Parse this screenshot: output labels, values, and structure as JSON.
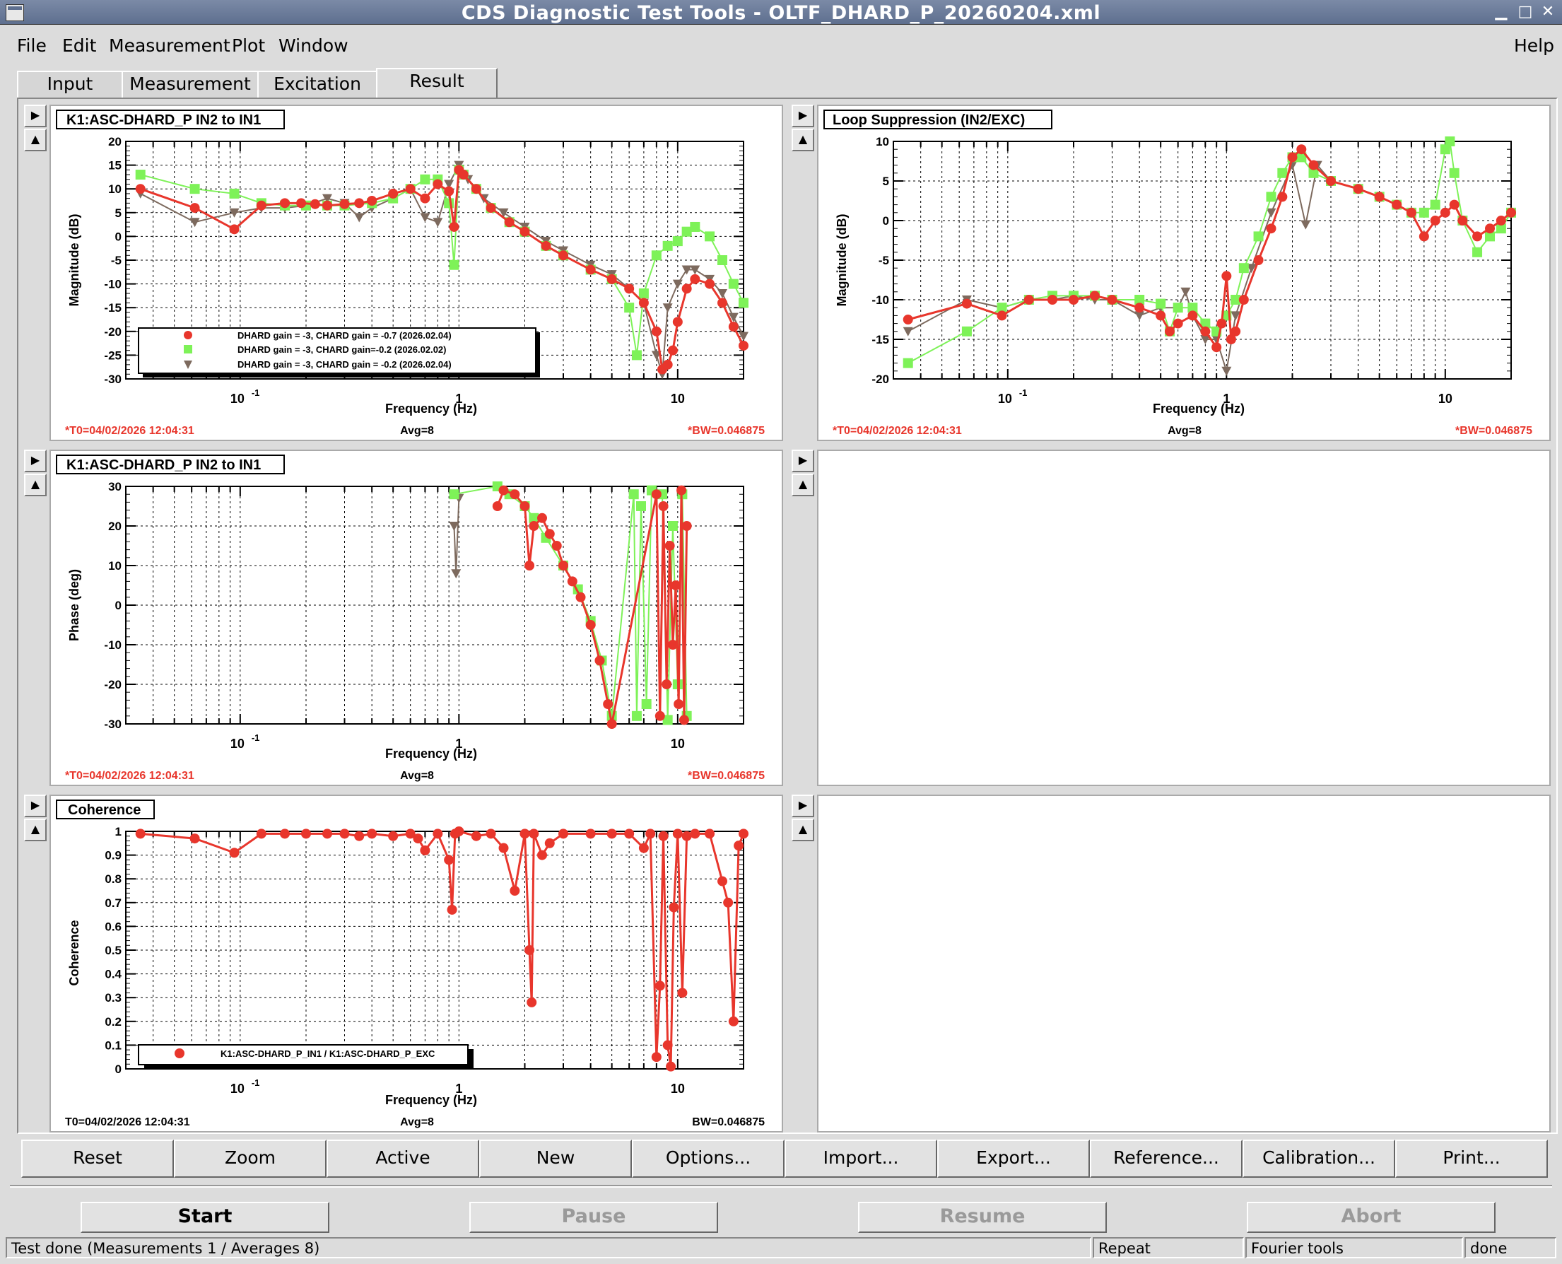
{
  "window": {
    "title": "CDS Diagnostic Test Tools - OLTF_DHARD_P_20260204.xml",
    "minimize": "▁",
    "maximize": "□",
    "close": "✕"
  },
  "menu": {
    "file": "File",
    "edit": "Edit",
    "measurement": "Measurement",
    "plot": "Plot",
    "window": "Window",
    "help": "Help"
  },
  "tabs": {
    "input": "Input",
    "measurement": "Measurement",
    "excitation": "Excitation",
    "result": "Result"
  },
  "colors": {
    "series1": "#e8362c",
    "series2": "#7ef258",
    "series3": "#7d6a5e",
    "info_red": "#e8362c"
  },
  "pads": {
    "mag": {
      "title": "K1:ASC-DHARD_P IN2 to IN1",
      "ylabel": "Magnitude (dB)",
      "xlabel": "Frequency (Hz)",
      "footer_left": "*T0=04/02/2026 12:04:31",
      "footer_mid": "Avg=8",
      "footer_right": "*BW=0.046875",
      "legend": [
        "DHARD gain = -3, CHARD gain = -0.7 (2026.02.04)",
        "DHARD gain = -3, CHARD gain=-0.2  (2026.02.02)",
        "DHARD gain = -3, CHARD gain = -0.2 (2026.02.04)"
      ]
    },
    "supp": {
      "title": "Loop Suppression (IN2/EXC)",
      "ylabel": "Magnitude (dB)",
      "xlabel": "Frequency (Hz)",
      "footer_left": "*T0=04/02/2026 12:04:31",
      "footer_mid": "Avg=8",
      "footer_right": "*BW=0.046875"
    },
    "phase": {
      "title": "K1:ASC-DHARD_P IN2 to IN1",
      "ylabel": "Phase (deg)",
      "xlabel": "Frequency (Hz)",
      "footer_left": "*T0=04/02/2026 12:04:31",
      "footer_mid": "Avg=8",
      "footer_right": "*BW=0.046875"
    },
    "coh": {
      "title": "Coherence",
      "ylabel": "Coherence",
      "xlabel": "Frequency (Hz)",
      "footer_left": "T0=04/02/2026 12:04:31",
      "footer_mid": "Avg=8",
      "footer_right": "BW=0.046875",
      "legend": [
        "K1:ASC-DHARD_P_IN1 / K1:ASC-DHARD_P_EXC"
      ]
    }
  },
  "toolbar": {
    "reset": "Reset",
    "zoom": "Zoom",
    "active": "Active",
    "new": "New",
    "options": "Options...",
    "import": "Import...",
    "export": "Export...",
    "reference": "Reference...",
    "calibration": "Calibration...",
    "print": "Print..."
  },
  "controls": {
    "start": "Start",
    "pause": "Pause",
    "resume": "Resume",
    "abort": "Abort"
  },
  "status": {
    "message": "Test done (Measurements 1 / Averages 8)",
    "repeat": "Repeat",
    "tool": "Fourier tools",
    "state": "done"
  },
  "chart_data": [
    {
      "id": "mag",
      "type": "scatter",
      "title": "K1:ASC-DHARD_P IN2 to IN1",
      "xlabel": "Frequency (Hz)",
      "ylabel": "Magnitude (dB)",
      "xscale": "log",
      "xlim": [
        0.03,
        20
      ],
      "ylim": [
        -30,
        20
      ],
      "yticks": [
        -30,
        -25,
        -20,
        -15,
        -10,
        -5,
        0,
        5,
        10,
        15,
        20
      ],
      "xticklabels": [
        "10^-1",
        "1",
        "10"
      ],
      "grid": true,
      "legend": "bottom-left",
      "series": [
        {
          "name": "DHARD gain = -3, CHARD gain = -0.7 (2026.02.04)",
          "marker": "circle",
          "x": [
            0.035,
            0.062,
            0.094,
            0.125,
            0.16,
            0.19,
            0.22,
            0.25,
            0.3,
            0.35,
            0.4,
            0.5,
            0.6,
            0.7,
            0.8,
            0.9,
            0.95,
            1.0,
            1.05,
            1.2,
            1.4,
            1.7,
            2.0,
            2.5,
            3,
            4,
            5,
            6,
            7,
            8,
            8.5,
            9,
            9.5,
            10,
            11,
            12,
            14,
            16,
            18,
            20
          ],
          "y": [
            10,
            6,
            1.5,
            6.5,
            7,
            7,
            6.8,
            6.5,
            6.8,
            7,
            7.5,
            9,
            10,
            8,
            11,
            9.5,
            2,
            14,
            13,
            10,
            6,
            3,
            1,
            -2,
            -4,
            -7,
            -9,
            -11,
            -14,
            -20,
            -28,
            -27,
            -24,
            -18,
            -11,
            -9,
            -10,
            -14,
            -19,
            -23
          ]
        },
        {
          "name": "DHARD gain = -3, CHARD gain=-0.2  (2026.02.02)",
          "marker": "square",
          "x": [
            0.035,
            0.062,
            0.094,
            0.125,
            0.16,
            0.2,
            0.25,
            0.3,
            0.4,
            0.5,
            0.6,
            0.7,
            0.8,
            0.9,
            0.95,
            1.0,
            1.05,
            1.2,
            1.4,
            1.7,
            2.0,
            2.5,
            3,
            4,
            5,
            6,
            6.5,
            7,
            8,
            9,
            10,
            11,
            12,
            14,
            16,
            18,
            20
          ],
          "y": [
            13,
            10,
            9,
            7,
            6.5,
            6.5,
            6.5,
            6.5,
            7,
            8,
            10,
            12,
            12,
            7,
            -6,
            14,
            13,
            10,
            6,
            3,
            1,
            -2,
            -4,
            -7,
            -9,
            -15,
            -25,
            -12,
            -4,
            -2,
            -1,
            1,
            2,
            0,
            -5,
            -10,
            -14
          ]
        },
        {
          "name": "DHARD gain = -3, CHARD gain = -0.2 (2026.02.04)",
          "marker": "triangle-down",
          "x": [
            0.035,
            0.062,
            0.094,
            0.125,
            0.16,
            0.2,
            0.25,
            0.3,
            0.35,
            0.4,
            0.5,
            0.6,
            0.7,
            0.8,
            0.9,
            1.0,
            1.1,
            1.3,
            1.6,
            2.0,
            2.5,
            3,
            4,
            5,
            6,
            7,
            8,
            8.5,
            9,
            10,
            11,
            12,
            14,
            16,
            18,
            20
          ],
          "y": [
            9,
            3,
            5,
            6,
            6,
            6.5,
            8,
            7,
            4,
            6,
            8,
            10,
            4,
            3,
            11,
            15,
            12,
            8,
            5,
            2,
            -1,
            -3,
            -6,
            -8,
            -11,
            -14,
            -25,
            -29,
            -15,
            -10,
            -7,
            -7,
            -9,
            -12,
            -17,
            -21
          ]
        }
      ]
    },
    {
      "id": "supp",
      "type": "scatter",
      "title": "Loop Suppression (IN2/EXC)",
      "xlabel": "Frequency (Hz)",
      "ylabel": "Magnitude (dB)",
      "xscale": "log",
      "xlim": [
        0.03,
        20
      ],
      "ylim": [
        -20,
        10
      ],
      "yticks": [
        -20,
        -15,
        -10,
        -5,
        0,
        5,
        10
      ],
      "xticklabels": [
        "10^-1",
        "1",
        "10"
      ],
      "grid": true,
      "series": [
        {
          "name": "",
          "marker": "circle",
          "x": [
            0.035,
            0.065,
            0.094,
            0.125,
            0.16,
            0.2,
            0.25,
            0.3,
            0.4,
            0.5,
            0.55,
            0.6,
            0.7,
            0.8,
            0.9,
            0.95,
            1.0,
            1.05,
            1.1,
            1.2,
            1.4,
            1.6,
            1.8,
            2.0,
            2.2,
            2.5,
            3,
            4,
            5,
            6,
            7,
            8,
            9,
            10,
            11,
            12,
            14,
            16,
            18,
            20
          ],
          "y": [
            -12.5,
            -10.5,
            -12,
            -10,
            -10,
            -10,
            -9.5,
            -10,
            -11,
            -12,
            -14,
            -13,
            -12,
            -14,
            -16,
            -13,
            -7,
            -15,
            -14,
            -10,
            -5,
            -1,
            3,
            8,
            9,
            7,
            5,
            4,
            3,
            2,
            1,
            -2,
            0,
            1,
            2,
            0,
            -2,
            -1,
            0,
            1
          ]
        },
        {
          "name": "",
          "marker": "square",
          "x": [
            0.035,
            0.065,
            0.094,
            0.125,
            0.16,
            0.2,
            0.25,
            0.3,
            0.4,
            0.5,
            0.55,
            0.6,
            0.7,
            0.8,
            0.9,
            1.0,
            1.1,
            1.2,
            1.4,
            1.6,
            1.8,
            2.0,
            2.2,
            2.5,
            3,
            4,
            5,
            6,
            7,
            8,
            9,
            10,
            10.5,
            11,
            12,
            14,
            16,
            18,
            20
          ],
          "y": [
            -18,
            -14,
            -11,
            -10,
            -9.5,
            -9.5,
            -9.5,
            -10,
            -10,
            -10.5,
            -14,
            -11,
            -11,
            -13,
            -14,
            -12,
            -10,
            -6,
            -2,
            3,
            6,
            8,
            8,
            6,
            5,
            4,
            3,
            2,
            1,
            1,
            2,
            9,
            10,
            6,
            0,
            -4,
            -2,
            -1,
            1
          ]
        },
        {
          "name": "",
          "marker": "triangle-down",
          "x": [
            0.035,
            0.065,
            0.094,
            0.125,
            0.16,
            0.2,
            0.25,
            0.3,
            0.4,
            0.5,
            0.6,
            0.65,
            0.7,
            0.8,
            0.9,
            1.0,
            1.1,
            1.3,
            1.6,
            2.0,
            2.3,
            2.6,
            3,
            4,
            5,
            6,
            7
          ],
          "y": [
            -14,
            -10,
            -11,
            -10,
            -10,
            -9.5,
            -10,
            -10,
            -12,
            -11,
            -11,
            -9,
            -12,
            -15,
            -15,
            -19,
            -12,
            -6,
            1,
            7,
            -0.5,
            7,
            5,
            4,
            3,
            2,
            1
          ]
        }
      ]
    },
    {
      "id": "phase",
      "type": "scatter",
      "title": "K1:ASC-DHARD_P IN2 to IN1",
      "xlabel": "Frequency (Hz)",
      "ylabel": "Phase (deg)",
      "xscale": "log",
      "xlim": [
        0.03,
        20
      ],
      "ylim": [
        -30,
        30
      ],
      "yticks": [
        -30,
        -20,
        -10,
        0,
        10,
        20,
        30
      ],
      "xticklabels": [
        "10^-1",
        "1",
        "10"
      ],
      "grid": true,
      "series": [
        {
          "name": "",
          "marker": "circle",
          "x": [
            1.5,
            1.6,
            1.8,
            2.0,
            2.1,
            2.2,
            2.4,
            2.6,
            2.8,
            3.0,
            3.3,
            3.6,
            4.0,
            4.4,
            4.8,
            5.0,
            8.0,
            8.3,
            8.6,
            8.9,
            9.2,
            9.5,
            9.8,
            10.1,
            10.4,
            10.7,
            11.0
          ],
          "y": [
            25,
            29,
            28,
            25,
            10,
            20,
            22,
            18,
            15,
            10,
            6,
            2,
            -5,
            -14,
            -25,
            -30,
            28,
            -28,
            25,
            -20,
            15,
            -10,
            5,
            -25,
            29,
            -29,
            20
          ]
        },
        {
          "name": "",
          "marker": "square",
          "x": [
            0.95,
            1.5,
            1.7,
            2.0,
            2.2,
            2.5,
            3.0,
            3.5,
            4.0,
            4.5,
            5.0,
            6.3,
            6.5,
            6.8,
            7.2,
            7.6,
            8.5,
            9.0,
            9.5,
            10.0,
            10.5,
            11.0
          ],
          "y": [
            28,
            30,
            28,
            25,
            22,
            17,
            10,
            4,
            -4,
            -14,
            -28,
            28,
            -28,
            25,
            -25,
            29,
            28,
            -29,
            20,
            -20,
            28,
            -28
          ]
        },
        {
          "name": "",
          "marker": "triangle-down",
          "x": [
            0.95,
            0.97,
            1.0
          ],
          "y": [
            20,
            8,
            27
          ]
        }
      ]
    },
    {
      "id": "coh",
      "type": "scatter",
      "title": "Coherence",
      "xlabel": "Frequency (Hz)",
      "ylabel": "Coherence",
      "xscale": "log",
      "xlim": [
        0.03,
        20
      ],
      "ylim": [
        0,
        1
      ],
      "yticks": [
        0,
        0.1,
        0.2,
        0.3,
        0.4,
        0.5,
        0.6,
        0.7,
        0.8,
        0.9,
        1
      ],
      "xticklabels": [
        "10^-1",
        "1",
        "10"
      ],
      "grid": true,
      "legend": "bottom-left",
      "series": [
        {
          "name": "K1:ASC-DHARD_P_IN1 / K1:ASC-DHARD_P_EXC",
          "marker": "circle",
          "x": [
            0.035,
            0.062,
            0.094,
            0.125,
            0.16,
            0.2,
            0.25,
            0.3,
            0.35,
            0.4,
            0.5,
            0.6,
            0.65,
            0.7,
            0.8,
            0.9,
            0.93,
            0.96,
            1.0,
            1.2,
            1.4,
            1.6,
            1.8,
            2.0,
            2.1,
            2.15,
            2.2,
            2.4,
            2.6,
            3,
            4,
            5,
            6,
            7,
            7.5,
            8,
            8.3,
            8.6,
            9,
            9.3,
            9.6,
            10,
            10.5,
            11,
            12,
            14,
            16,
            17,
            18,
            19,
            20
          ],
          "y": [
            0.99,
            0.97,
            0.91,
            0.99,
            0.99,
            0.99,
            0.99,
            0.99,
            0.98,
            0.99,
            0.98,
            0.99,
            0.97,
            0.92,
            0.99,
            0.88,
            0.67,
            0.99,
            1.0,
            0.98,
            0.99,
            0.93,
            0.75,
            0.99,
            0.5,
            0.28,
            0.99,
            0.9,
            0.95,
            0.99,
            0.99,
            0.99,
            0.99,
            0.93,
            0.99,
            0.05,
            0.35,
            0.98,
            0.1,
            0.01,
            0.68,
            0.99,
            0.32,
            0.98,
            0.99,
            0.99,
            0.79,
            0.7,
            0.2,
            0.94,
            0.99
          ]
        }
      ]
    }
  ]
}
